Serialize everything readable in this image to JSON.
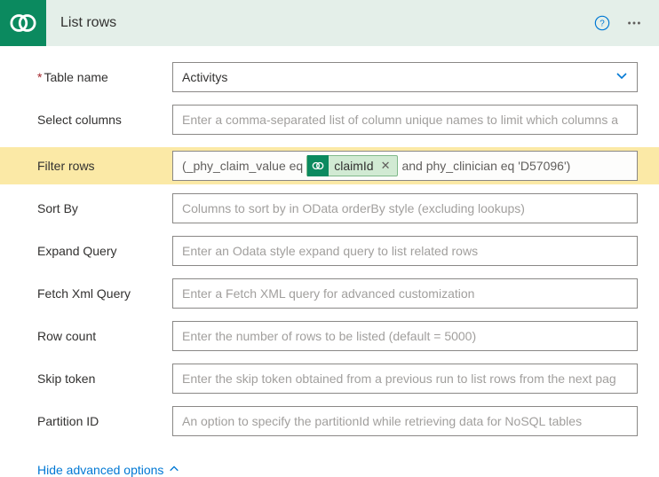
{
  "header": {
    "title": "List rows"
  },
  "fields": {
    "table_name": {
      "label": "Table name",
      "value": "Activitys"
    },
    "select_columns": {
      "label": "Select columns",
      "placeholder": "Enter a comma-separated list of column unique names to limit which columns a"
    },
    "filter_rows": {
      "label": "Filter rows",
      "prefix": "(_phy_claim_value eq",
      "token": "claimId",
      "suffix": "and phy_clinician eq 'D57096')"
    },
    "sort_by": {
      "label": "Sort By",
      "placeholder": "Columns to sort by in OData orderBy style (excluding lookups)"
    },
    "expand_query": {
      "label": "Expand Query",
      "placeholder": "Enter an Odata style expand query to list related rows"
    },
    "fetch_xml": {
      "label": "Fetch Xml Query",
      "placeholder": "Enter a Fetch XML query for advanced customization"
    },
    "row_count": {
      "label": "Row count",
      "placeholder": "Enter the number of rows to be listed (default = 5000)"
    },
    "skip_token": {
      "label": "Skip token",
      "placeholder": "Enter the skip token obtained from a previous run to list rows from the next pag"
    },
    "partition_id": {
      "label": "Partition ID",
      "placeholder": "An option to specify the partitionId while retrieving data for NoSQL tables"
    }
  },
  "footer": {
    "hide_advanced": "Hide advanced options"
  }
}
